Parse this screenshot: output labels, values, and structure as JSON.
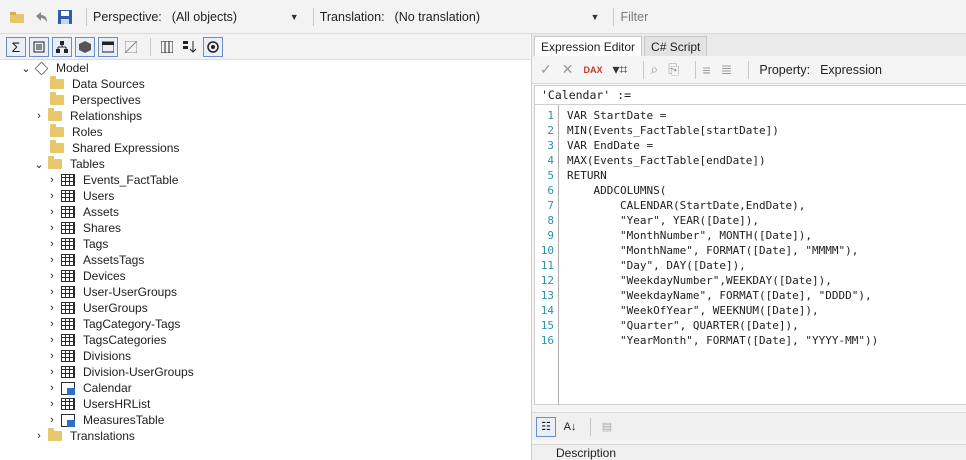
{
  "toolbar": {
    "perspective_label": "Perspective:",
    "perspective_value": "(All objects)",
    "translation_label": "Translation:",
    "translation_value": "(No translation)",
    "filter_label": "Filter"
  },
  "tree": {
    "items": [
      {
        "label": "Model"
      },
      {
        "label": "Data Sources"
      },
      {
        "label": "Perspectives"
      },
      {
        "label": "Relationships"
      },
      {
        "label": "Roles"
      },
      {
        "label": "Shared Expressions"
      },
      {
        "label": "Tables"
      },
      {
        "label": "Events_FactTable"
      },
      {
        "label": "Users"
      },
      {
        "label": "Assets"
      },
      {
        "label": "Shares"
      },
      {
        "label": "Tags"
      },
      {
        "label": "AssetsTags"
      },
      {
        "label": "Devices"
      },
      {
        "label": "User-UserGroups"
      },
      {
        "label": "UserGroups"
      },
      {
        "label": "TagCategory-Tags"
      },
      {
        "label": "TagsCategories"
      },
      {
        "label": "Divisions"
      },
      {
        "label": "Division-UserGroups"
      },
      {
        "label": "Calendar"
      },
      {
        "label": "UsersHRList"
      },
      {
        "label": "MeasuresTable"
      },
      {
        "label": "Translations"
      }
    ]
  },
  "editor_panel": {
    "tabs": [
      {
        "label": "Expression Editor"
      },
      {
        "label": "C# Script"
      }
    ],
    "property_label": "Property:",
    "property_value": "Expression",
    "expression_header": "'Calendar' :=",
    "line_numbers": [
      "1",
      "2",
      "3",
      "4",
      "5",
      "6",
      "7",
      "8",
      "9",
      "10",
      "11",
      "12",
      "13",
      "14",
      "15",
      "16"
    ],
    "code_lines": [
      "VAR StartDate =",
      "MIN(Events_FactTable[startDate])",
      "VAR EndDate =",
      "MAX(Events_FactTable[endDate])",
      "RETURN",
      "    ADDCOLUMNS(",
      "        CALENDAR(StartDate,EndDate),",
      "        \"Year\", YEAR([Date]),",
      "        \"MonthNumber\", MONTH([Date]),",
      "        \"MonthName\", FORMAT([Date], \"MMMM\"),",
      "        \"Day\", DAY([Date]),",
      "        \"WeekdayNumber\",WEEKDAY([Date]),",
      "        \"WeekdayName\", FORMAT([Date], \"DDDD\"),",
      "        \"WeekOfYear\", WEEKNUM([Date]),",
      "        \"Quarter\", QUARTER([Date]),",
      "        \"YearMonth\", FORMAT([Date], \"YYYY-MM\"))"
    ],
    "description_label": "Description"
  }
}
